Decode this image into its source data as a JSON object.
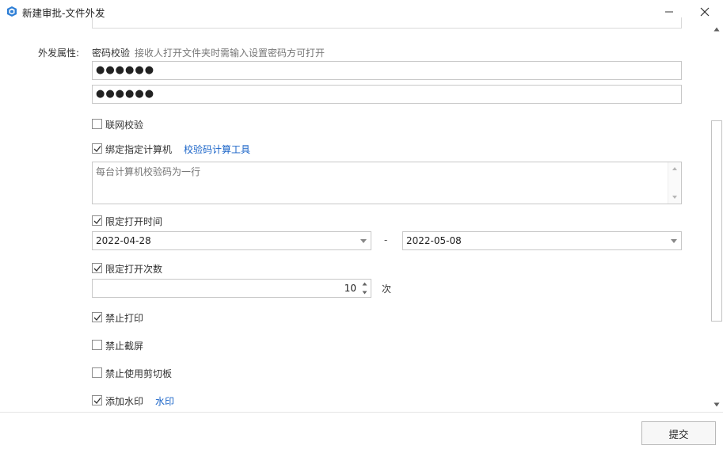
{
  "window": {
    "title": "新建审批-文件外发"
  },
  "form": {
    "attr_label": "外发属性:",
    "password_check_label": "密码校验",
    "password_hint": "接收人打开文件夹时需输入设置密码方可打开",
    "password": "●●●●●●",
    "password_confirm": "●●●●●●",
    "network_check": {
      "label": "联网校验",
      "checked": false
    },
    "bind_computer": {
      "label": "绑定指定计算机",
      "checked": true,
      "link": "校验码计算工具"
    },
    "computer_codes_placeholder": "每台计算机校验码为一行",
    "limit_time": {
      "label": "限定打开时间",
      "checked": true,
      "start": "2022-04-28",
      "separator": "-",
      "end": "2022-05-08"
    },
    "limit_count": {
      "label": "限定打开次数",
      "checked": true,
      "value": "10",
      "unit": "次"
    },
    "no_print": {
      "label": "禁止打印",
      "checked": true
    },
    "no_screenshot": {
      "label": "禁止截屏",
      "checked": false
    },
    "no_clipboard": {
      "label": "禁止使用剪切板",
      "checked": false
    },
    "watermark": {
      "label": "添加水印",
      "checked": true,
      "link": "水印"
    }
  },
  "footer": {
    "submit_label": "提交"
  },
  "colors": {
    "link": "#1a64c8",
    "border": "#c8c8c8"
  }
}
